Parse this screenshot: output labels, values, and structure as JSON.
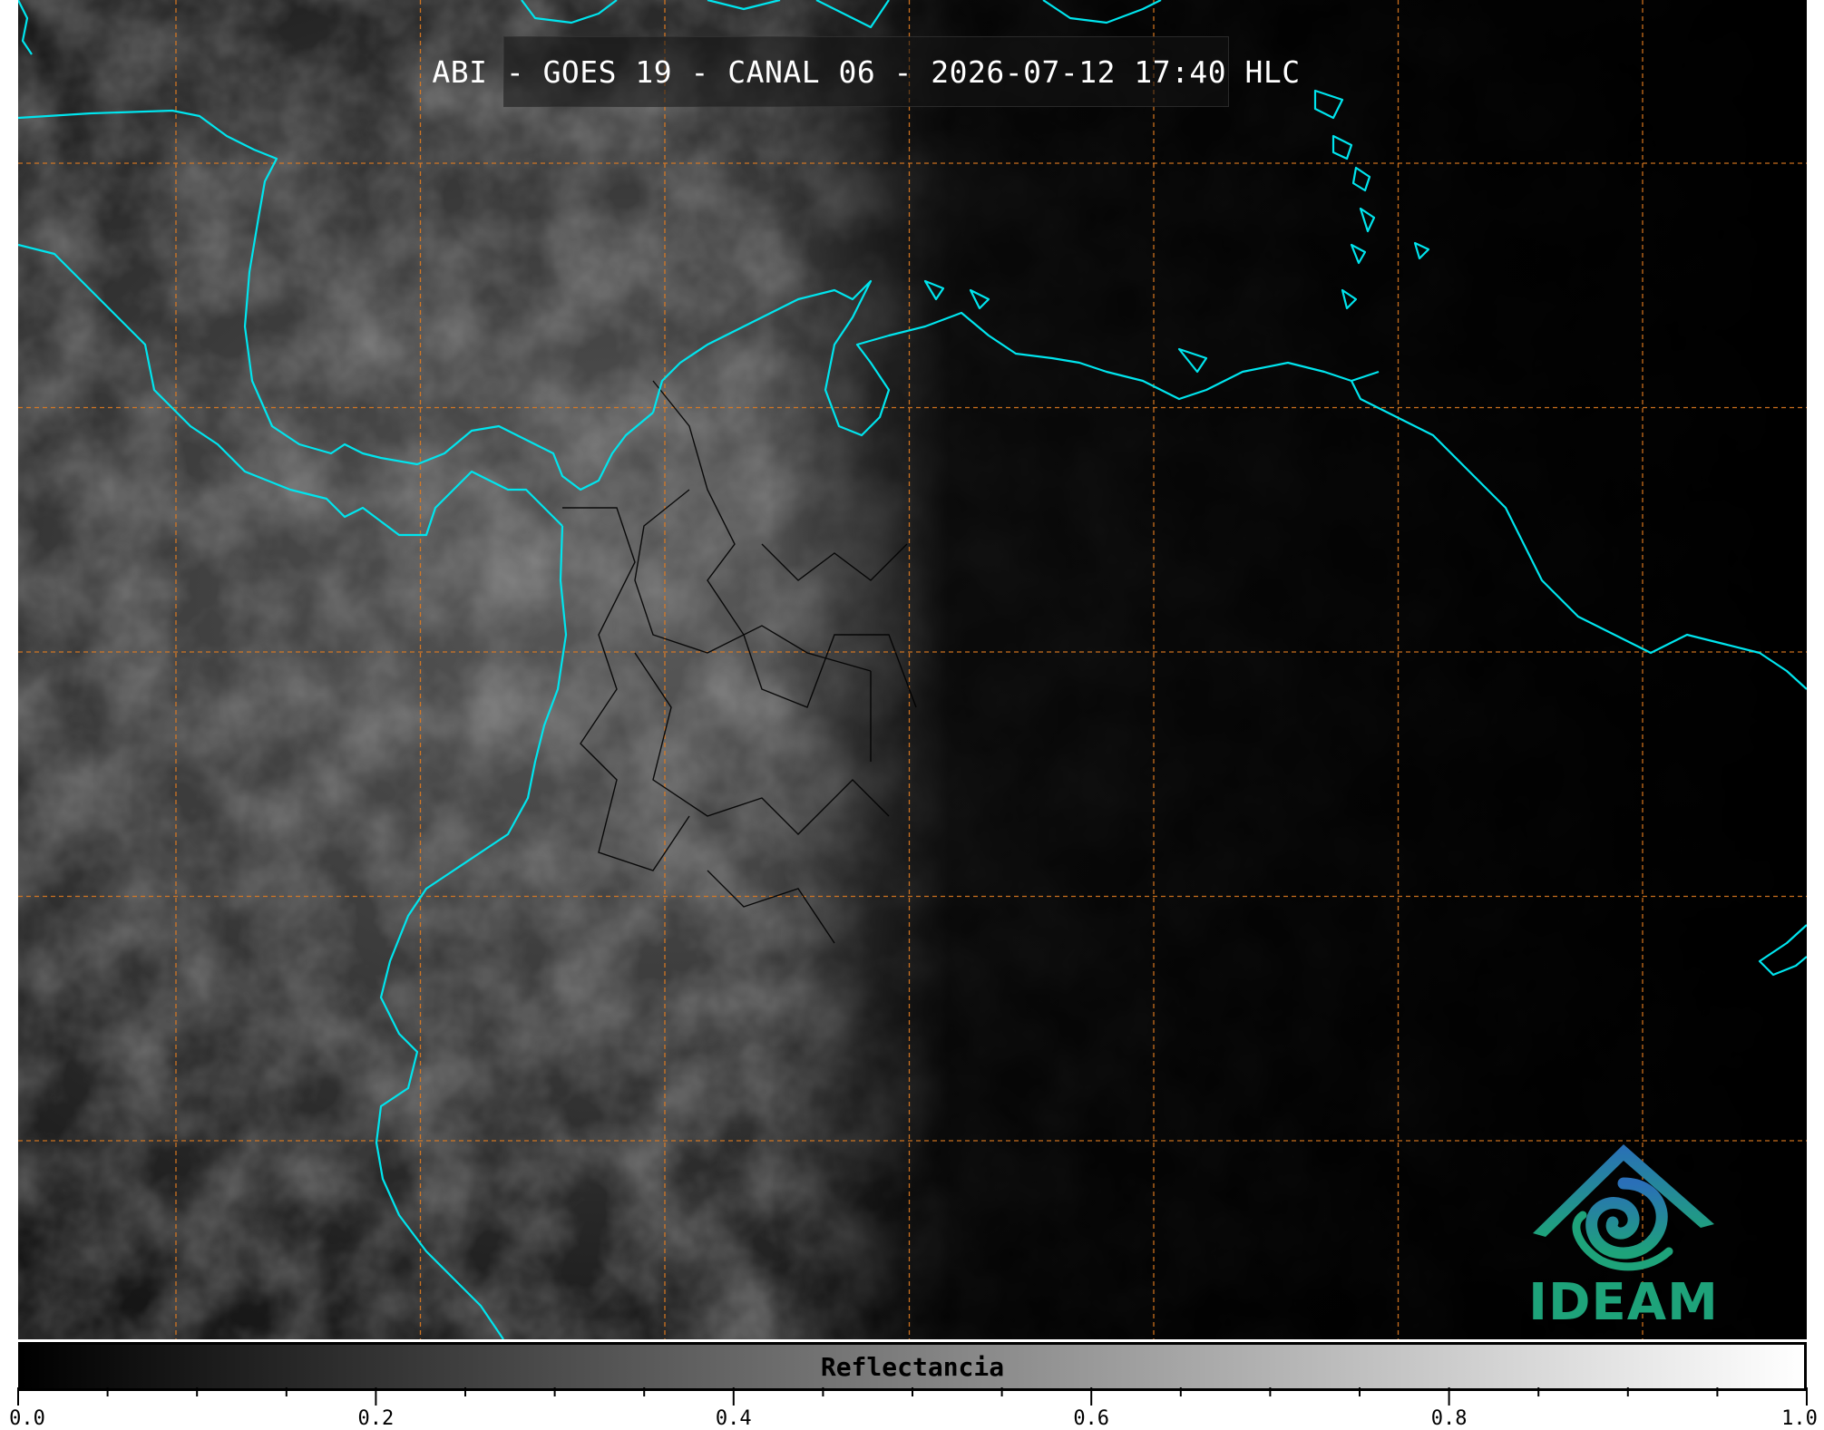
{
  "title": "ABI - GOES 19 - CANAL 06 - 2026-07-12 17:40 HLC",
  "logo": {
    "text": "IDEAM",
    "icon": "ideam-logo-icon"
  },
  "colorbar": {
    "label": "Reflectancia",
    "min": 0.0,
    "max": 1.0,
    "major_ticks": [
      "0.0",
      "0.2",
      "0.4",
      "0.6",
      "0.8",
      "1.0"
    ],
    "minor_step": 0.05,
    "colors": {
      "low": "#000000",
      "high": "#ffffff"
    }
  },
  "map": {
    "coastline_color": "#00e5ee",
    "border_color": "#000000",
    "grid_color": "#e07b20",
    "background": "#000000"
  }
}
